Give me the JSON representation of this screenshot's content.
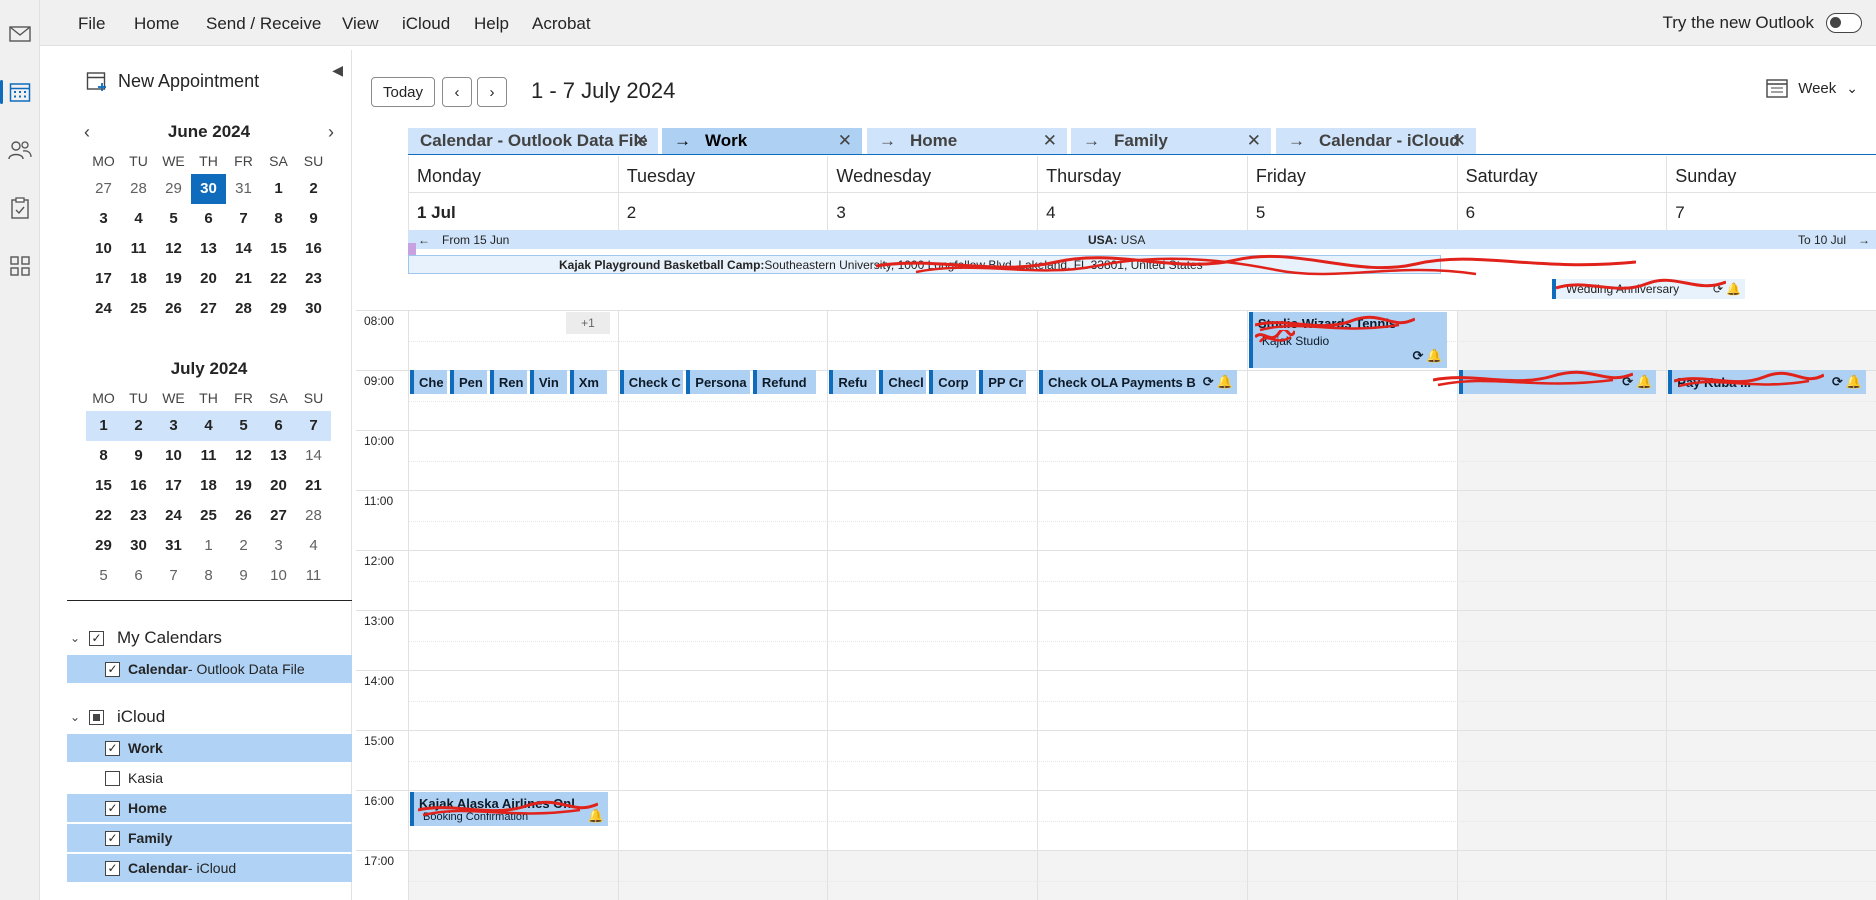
{
  "menu": [
    "File",
    "Home",
    "Send / Receive",
    "View",
    "iCloud",
    "Help",
    "Acrobat"
  ],
  "try_new": "Try the new Outlook",
  "nav": {
    "new_appointment": "New Appointment",
    "june": {
      "title": "June 2024",
      "dow": [
        "MO",
        "TU",
        "WE",
        "TH",
        "FR",
        "SA",
        "SU"
      ],
      "days": [
        "27",
        "28",
        "29",
        "30",
        "31",
        "1",
        "2",
        "3",
        "4",
        "5",
        "6",
        "7",
        "8",
        "9",
        "10",
        "11",
        "12",
        "13",
        "14",
        "15",
        "16",
        "17",
        "18",
        "19",
        "20",
        "21",
        "22",
        "23",
        "24",
        "25",
        "26",
        "27",
        "28",
        "29",
        "30"
      ]
    },
    "july": {
      "title": "July 2024",
      "dow": [
        "MO",
        "TU",
        "WE",
        "TH",
        "FR",
        "SA",
        "SU"
      ],
      "days": [
        "1",
        "2",
        "3",
        "4",
        "5",
        "6",
        "7",
        "8",
        "9",
        "10",
        "11",
        "12",
        "13",
        "14",
        "15",
        "16",
        "17",
        "18",
        "19",
        "20",
        "21",
        "22",
        "23",
        "24",
        "25",
        "26",
        "27",
        "28",
        "29",
        "30",
        "31",
        "1",
        "2",
        "3",
        "4",
        "5",
        "6",
        "7",
        "8",
        "9",
        "10",
        "11"
      ]
    },
    "my_calendars": "My Calendars",
    "icloud": "iCloud",
    "calendars": [
      {
        "bold": "Calendar",
        "rest": " - Outlook Data File",
        "checked": true,
        "selected": true
      },
      {
        "bold": "Work",
        "rest": "",
        "checked": true,
        "selected": true
      },
      {
        "bold": "",
        "rest": "Kasia",
        "checked": false,
        "selected": false
      },
      {
        "bold": "Home",
        "rest": "",
        "checked": true,
        "selected": true
      },
      {
        "bold": "Family",
        "rest": "",
        "checked": true,
        "selected": true
      },
      {
        "bold": "Calendar",
        "rest": " - iCloud",
        "checked": true,
        "selected": true
      }
    ]
  },
  "toolbar": {
    "today": "Today",
    "range": "1 - 7 July 2024",
    "view": "Week"
  },
  "tabs": [
    "Calendar - Outlook Data File",
    "Work",
    "Home",
    "Family",
    "Calendar - iCloud"
  ],
  "days": [
    {
      "name": "Monday",
      "date": "1 Jul"
    },
    {
      "name": "Tuesday",
      "date": "2"
    },
    {
      "name": "Wednesday",
      "date": "3"
    },
    {
      "name": "Thursday",
      "date": "4"
    },
    {
      "name": "Friday",
      "date": "5"
    },
    {
      "name": "Saturday",
      "date": "6"
    },
    {
      "name": "Sunday",
      "date": "7"
    }
  ],
  "banner": {
    "from": "From 15 Jun",
    "center_bold": "USA:",
    "center_rest": " USA",
    "to": "To 10 Jul"
  },
  "allday_event": {
    "bold": "Kajak Playground Basketball Camp:",
    "rest": " Southeastern University, 1000 Longfellow Blvd, Lakeland, FL 33801, United States"
  },
  "friday_allday": "Wedding Anniversary",
  "hours": [
    "08:00",
    "09:00",
    "10:00",
    "11:00",
    "12:00",
    "13:00",
    "14:00",
    "15:00",
    "16:00",
    "17:00"
  ],
  "more_label": "+1",
  "events": {
    "mon": [
      "Che",
      "Pen",
      "Ren",
      "Vin",
      "Xm"
    ],
    "tue": [
      "Check C",
      "Persona",
      "Refund"
    ],
    "wed": [
      "Refu",
      "Checl",
      "Corp",
      "PP Cr"
    ],
    "thu": "Check OLA Payments B",
    "fri_8": {
      "title": "Studio Wizards Tennis",
      "sub": "Kajak Studio"
    },
    "sat": "Sat placeholder",
    "sun": "Pay Kuba ..."
  },
  "monday_16": {
    "title": "Kajak Alaska Airlines Onl",
    "sub": "Booking Confirmation"
  }
}
